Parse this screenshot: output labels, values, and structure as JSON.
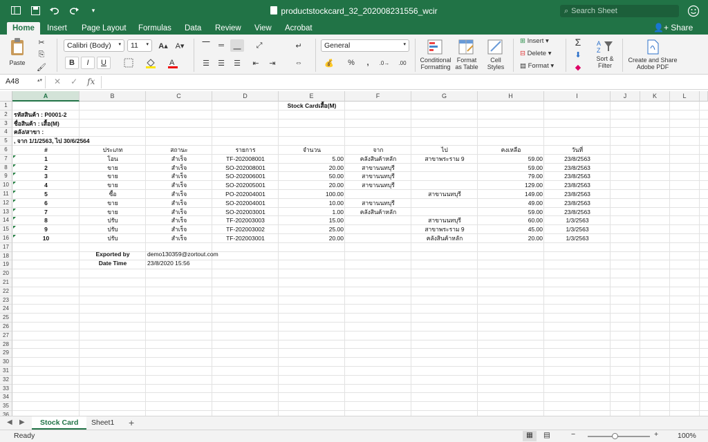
{
  "titlebar": {
    "filename": "productstockcard_32_202008231556_wcir",
    "search_placeholder": "Search Sheet"
  },
  "ribbon_tabs": [
    "Home",
    "Insert",
    "Page Layout",
    "Formulas",
    "Data",
    "Review",
    "View",
    "Acrobat"
  ],
  "share_label": "Share",
  "ribbon": {
    "paste_label": "Paste",
    "font_name": "Calibri (Body)",
    "font_size": "11",
    "number_format": "General",
    "conditional_formatting": "Conditional Formatting",
    "format_as_table": "Format as Table",
    "cell_styles": "Cell Styles",
    "insert": "Insert",
    "delete": "Delete",
    "format": "Format",
    "sort_filter": "Sort & Filter",
    "create_share_pdf": "Create and Share Adobe PDF",
    "bold": "B",
    "italic": "I",
    "underline": "U",
    "percent": "%"
  },
  "formula_bar": {
    "name_box": "A48",
    "fx": "fx",
    "value": ""
  },
  "columns": [
    "A",
    "B",
    "C",
    "D",
    "E",
    "F",
    "G",
    "H",
    "I",
    "J",
    "K",
    "L"
  ],
  "sheet": {
    "title": "Stock Cardเสื้อ(M)",
    "info": [
      "รหัสสินค้า : P0001-2",
      "ชื่อสินค้า : เสื้อ(M)",
      "คลัง/สาขา :",
      ", จาก 1/1/2563, ไป 30/6/2564"
    ],
    "headers": [
      "#",
      "ประเภท",
      "สถานะ",
      "รายการ",
      "จำนวน",
      "จาก",
      "ไป",
      "คงเหลือ",
      "วันที่"
    ],
    "rows": [
      [
        "1",
        "โอน",
        "สำเร็จ",
        "TF-202008001",
        "5.00",
        "คลังสินค้าหลัก",
        "สาขาพระราม 9",
        "59.00",
        "23/8/2563"
      ],
      [
        "2",
        "ขาย",
        "สำเร็จ",
        "SO-202008001",
        "20.00",
        "สาขานนทบุรี",
        "",
        "59.00",
        "23/8/2563"
      ],
      [
        "3",
        "ขาย",
        "สำเร็จ",
        "SO-202006001",
        "50.00",
        "สาขานนทบุรี",
        "",
        "79.00",
        "23/8/2563"
      ],
      [
        "4",
        "ขาย",
        "สำเร็จ",
        "SO-202005001",
        "20.00",
        "สาขานนทบุรี",
        "",
        "129.00",
        "23/8/2563"
      ],
      [
        "5",
        "ซื้อ",
        "สำเร็จ",
        "PO-202004001",
        "100.00",
        "",
        "สาขานนทบุรี",
        "149.00",
        "23/8/2563"
      ],
      [
        "6",
        "ขาย",
        "สำเร็จ",
        "SO-202004001",
        "10.00",
        "สาขานนทบุรี",
        "",
        "49.00",
        "23/8/2563"
      ],
      [
        "7",
        "ขาย",
        "สำเร็จ",
        "SO-202003001",
        "1.00",
        "คลังสินค้าหลัก",
        "",
        "59.00",
        "23/8/2563"
      ],
      [
        "8",
        "ปรับ",
        "สำเร็จ",
        "TF-202003003",
        "15.00",
        "",
        "สาขานนทบุรี",
        "60.00",
        "1/3/2563"
      ],
      [
        "9",
        "ปรับ",
        "สำเร็จ",
        "TF-202003002",
        "25.00",
        "",
        "สาขาพระราม 9",
        "45.00",
        "1/3/2563"
      ],
      [
        "10",
        "ปรับ",
        "สำเร็จ",
        "TF-202003001",
        "20.00",
        "",
        "คลังสินค้าหลัก",
        "20.00",
        "1/3/2563"
      ]
    ],
    "exported_by_label": "Exported by",
    "exported_by_value": "demo130359@zortout.com",
    "date_time_label": "Date Time",
    "date_time_value": "23/8/2020 15:56"
  },
  "sheet_tabs": [
    "Stock Card",
    "Sheet1"
  ],
  "status": {
    "ready": "Ready",
    "zoom": "100%"
  },
  "colors": {
    "excel_green": "#217346"
  }
}
